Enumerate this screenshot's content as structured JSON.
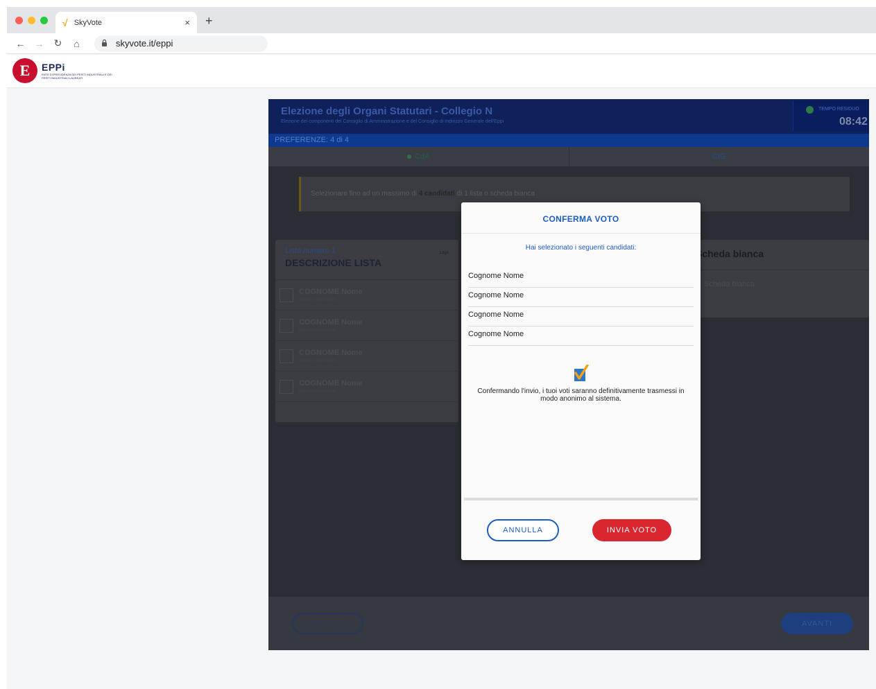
{
  "browser": {
    "tab_title": "SkyVote",
    "tab_close": "×",
    "new_tab": "+",
    "url": "skyvote.it/eppi",
    "nav": {
      "back": "←",
      "forward": "→",
      "reload": "↻",
      "home": "⌂"
    }
  },
  "site": {
    "logo_letter": "E",
    "logo_name": "EPPi",
    "logo_subtitle": "ENTE DI PREVIDENZA DEI PERITI INDUSTRIALI E DEI PERITI INDUSTRIALI LAUREATI"
  },
  "app": {
    "title": "Elezione degli Organi Statutari - Collegio N",
    "subtitle": "Elezione dei componenti del Consiglio di Amministrazione e del Consiglio di Indirizzo Generale dell'Eppi",
    "timer_label": "TEMPO RESIDUO",
    "timer_value": "08:42",
    "preferences": "PREFERENZE: 4 di 4",
    "tabs": [
      {
        "label": "CdA"
      },
      {
        "label": "CIG"
      }
    ],
    "notice_prefix": "Selezionare fino ad un massimo di ",
    "notice_bold": "4 candidati",
    "notice_suffix": " di 1 lista o scheda bianca",
    "list": {
      "number": "Lista numero 1",
      "description": "DESCRIZIONE LISTA",
      "logo_label": "Logo",
      "candidates": [
        {
          "name": "COGNOME Nome",
          "sub": "Nato/a il 00/00/0000"
        },
        {
          "name": "COGNOME Nome",
          "sub": "Nato/a il 00/00/0000"
        },
        {
          "name": "COGNOME Nome",
          "sub": "Nato/a il 00/00/0000"
        },
        {
          "name": "COGNOME Nome",
          "sub": "Nato/a il 00/00/0000"
        }
      ]
    },
    "blank": {
      "title": "Scheda bianca",
      "option": "Scheda bianca"
    },
    "footer": {
      "annulla": "ANNULLA",
      "avanti": "AVANTI"
    }
  },
  "modal": {
    "title": "CONFERMA VOTO",
    "intro": "Hai selezionato i seguenti candidati:",
    "candidates": [
      "Cognome Nome",
      "Cognome Nome",
      "Cognome Nome",
      "Cognome Nome"
    ],
    "message": "Confermando l'invio, i tuoi voti saranno definitivamente trasmessi in modo anonimo al sistema.",
    "annulla_label": "ANNULLA",
    "invia_label": "INVIA VOTO"
  },
  "colors": {
    "brand_red": "#c8102e",
    "accent_blue": "#1d5dbf",
    "confirm_red": "#d9262f",
    "header_navy": "#0e2158"
  }
}
